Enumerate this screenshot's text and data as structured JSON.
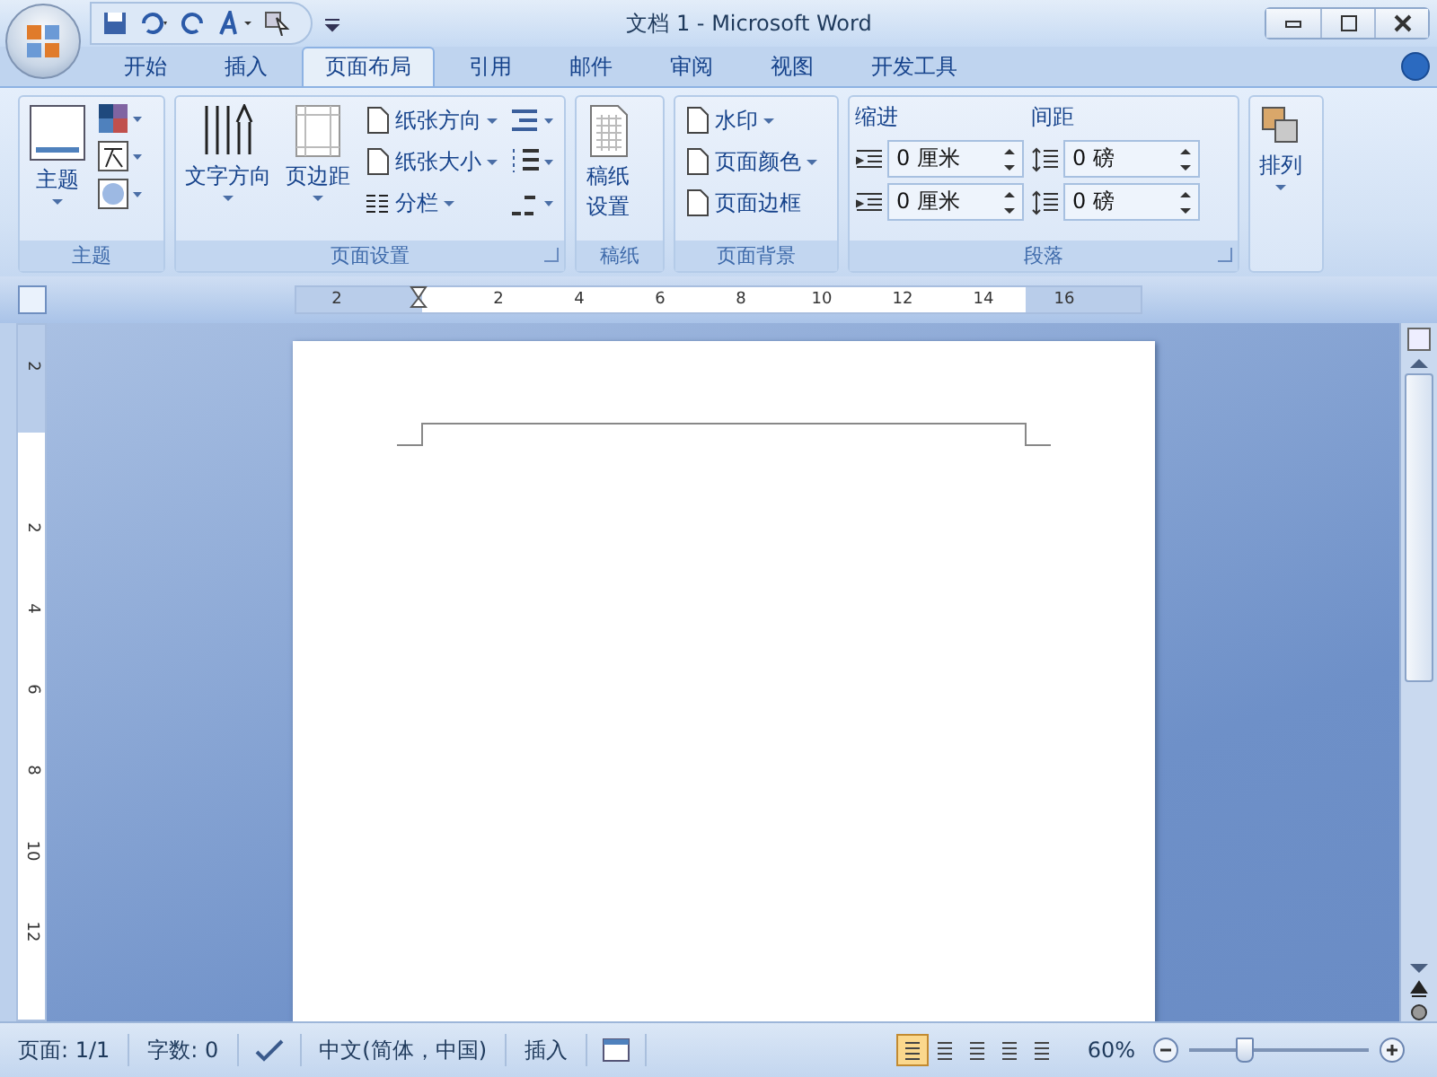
{
  "title_bar": {
    "title": "文档 1 - Microsoft Word"
  },
  "tabs": [
    {
      "label": "开始",
      "selected": false
    },
    {
      "label": "插入",
      "selected": false
    },
    {
      "label": "页面布局",
      "selected": true
    },
    {
      "label": "引用",
      "selected": false
    },
    {
      "label": "邮件",
      "selected": false
    },
    {
      "label": "审阅",
      "selected": false
    },
    {
      "label": "视图",
      "selected": false
    },
    {
      "label": "开发工具",
      "selected": false
    }
  ],
  "theme_group": {
    "label": "主题",
    "themes_button": "主题"
  },
  "page_setup_group": {
    "label": "页面设置",
    "text_direction": "文字方向",
    "margins": "页边距",
    "orientation": "纸张方向",
    "size": "纸张大小",
    "columns": "分栏"
  },
  "manuscript_group": {
    "label": "稿纸",
    "setup_button": "稿纸设置"
  },
  "background_group": {
    "label": "页面背景",
    "items": [
      "水印",
      "页面颜色",
      "页面边框"
    ]
  },
  "paragraph_group": {
    "label": "段落",
    "indent_label": "缩进",
    "indent": [
      "0 厘米",
      "0 厘米"
    ],
    "spacing_label": "间距",
    "spacing": [
      "0 磅",
      "0 磅"
    ]
  },
  "arrange_group": {
    "arrange_button": "排列"
  },
  "horizontal_ruler": {
    "labels": [
      "2",
      "2",
      "4",
      "6",
      "8",
      "10",
      "12",
      "14",
      "16"
    ]
  },
  "vertical_ruler": {
    "labels": [
      "2",
      "2",
      "4",
      "6",
      "8",
      "10",
      "12"
    ]
  },
  "status_bar": {
    "page": "页面: 1/1",
    "words": "字数: 0",
    "language": "中文(简体，中国)",
    "mode": "插入",
    "views": [
      {
        "selected": true
      },
      {
        "selected": false
      },
      {
        "selected": false
      },
      {
        "selected": false
      },
      {
        "selected": false
      }
    ],
    "zoom": "60%",
    "zoom_slider": {
      "level": 0.3
    }
  }
}
